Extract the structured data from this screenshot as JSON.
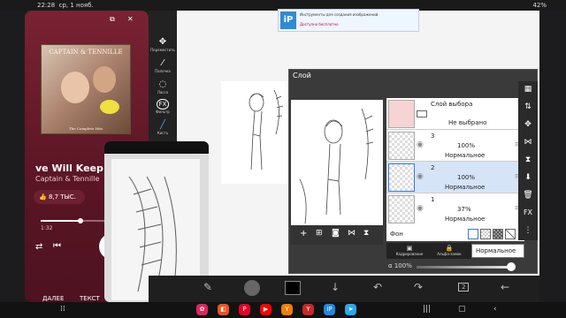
{
  "status_bar": {
    "time": "22:28",
    "date": "ср, 1 нояб.",
    "battery": "42%"
  },
  "music": {
    "album_title": "CAPTAIN & TENNILLE",
    "album_subtitle": "The Complete Hits",
    "song_title": "ve Will Keep U",
    "artist": "Captain & Tennille",
    "likes": "8,7 ТЫС.",
    "time_current": "1:32",
    "progress": 0.43,
    "tab_next": "ДАЛЕЕ",
    "tab_text": "ТЕКСТ"
  },
  "ad": {
    "line1": "Инструменты для создания изображений",
    "line2": "Доступно бесплатно"
  },
  "tools": [
    {
      "icon": "move-icon",
      "label": "Переместить"
    },
    {
      "icon": "lasso-icon",
      "label": "Палочка"
    },
    {
      "icon": "lasso-icon",
      "label": "Лассо"
    },
    {
      "icon": "fx-icon",
      "label": "Фильтр"
    },
    {
      "icon": "brush-icon",
      "label": "Кисть"
    },
    {
      "icon": "eraser-icon",
      "label": ""
    }
  ],
  "layer_panel": {
    "title": "Слой",
    "selection_layer": {
      "name": "Слой выбора",
      "state": "Не выбрано"
    },
    "layers": [
      {
        "number": "3",
        "opacity": "100%",
        "blend": "Нормальное"
      },
      {
        "number": "2",
        "opacity": "100%",
        "blend": "Нормальное"
      },
      {
        "number": "1",
        "opacity": "37%",
        "blend": "Нормальное"
      }
    ],
    "background_label": "Фон",
    "action_clip": "Кадрирование",
    "action_alpha": "Альфа-замок",
    "blend_mode": "Нормальное",
    "alpha_label": "α 100%",
    "alpha_value": 1.0
  },
  "bottom_bar": {
    "layer_count": "2"
  }
}
